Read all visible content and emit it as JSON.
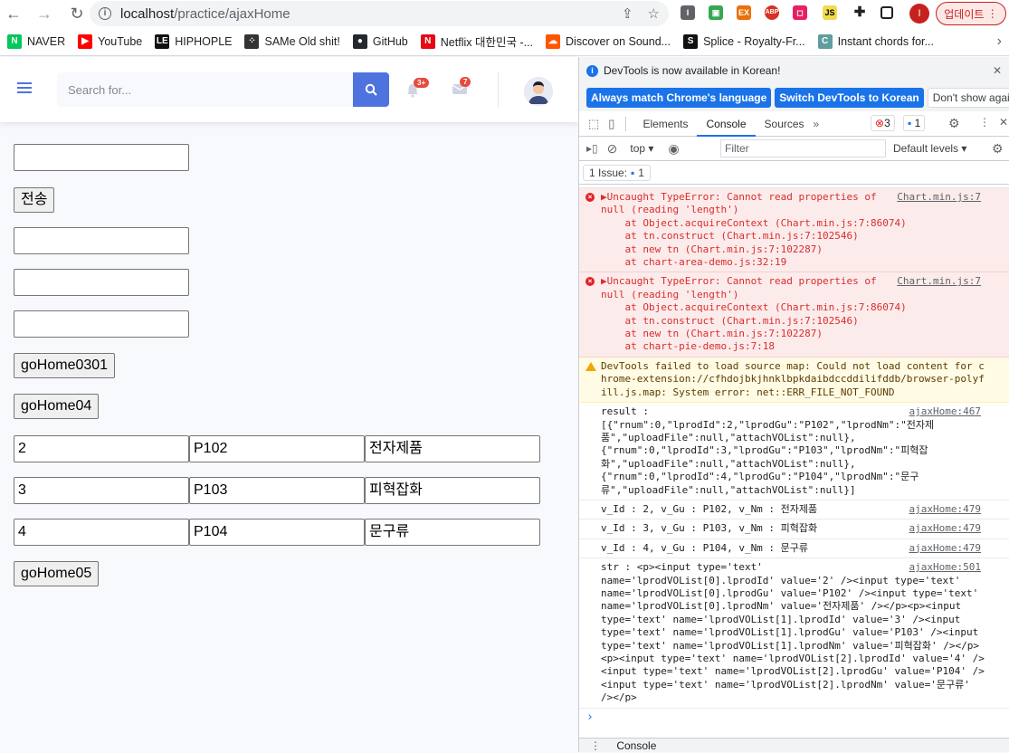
{
  "browser": {
    "url_host": "localhost",
    "url_path": "/practice/ajaxHome",
    "update_label": "업데이트",
    "profile_initial": "I"
  },
  "bookmarks": [
    {
      "label": "NAVER",
      "icon": "naver-icon",
      "color": "#03c75a",
      "glyph": "N"
    },
    {
      "label": "YouTube",
      "icon": "youtube-icon",
      "color": "#ff0000",
      "glyph": "▶"
    },
    {
      "label": "HIPHOPLE",
      "icon": "hiphople-icon",
      "color": "#111111",
      "glyph": "LE"
    },
    {
      "label": "SAMe Old shit!",
      "icon": "same-icon",
      "color": "#333333",
      "glyph": "⁘"
    },
    {
      "label": "GitHub",
      "icon": "github-icon",
      "color": "#24292e",
      "glyph": "●"
    },
    {
      "label": "Netflix 대한민국 -...",
      "icon": "netflix-icon",
      "color": "#e50914",
      "glyph": "N"
    },
    {
      "label": "Discover on Sound...",
      "icon": "soundcloud-icon",
      "color": "#ff5500",
      "glyph": "☁"
    },
    {
      "label": "Splice - Royalty-Fr...",
      "icon": "splice-icon",
      "color": "#111111",
      "glyph": "S"
    },
    {
      "label": "Instant chords for...",
      "icon": "chords-icon",
      "color": "#5f9ea0",
      "glyph": "C"
    }
  ],
  "header": {
    "search_placeholder": "Search for...",
    "alerts_badge": "3+",
    "messages_badge": "7"
  },
  "form": {
    "inputs_top": [
      "",
      "",
      "",
      ""
    ],
    "send_label": "전송",
    "go0301_label": "goHome0301",
    "go04_label": "goHome04",
    "rows": [
      {
        "id": "2",
        "gu": "P102",
        "nm": "전자제품"
      },
      {
        "id": "3",
        "gu": "P103",
        "nm": "피혁잡화"
      },
      {
        "id": "4",
        "gu": "P104",
        "nm": "문구류"
      }
    ],
    "go05_label": "goHome05"
  },
  "devtools": {
    "notice": "DevTools is now available in Korean!",
    "btn_match": "Always match Chrome's language",
    "btn_switch": "Switch DevTools to Korean",
    "btn_dismiss": "Don't show again",
    "tabs": [
      "Elements",
      "Console",
      "Sources"
    ],
    "active_tab": "Console",
    "error_count": "3",
    "info_count": "1",
    "context": "top",
    "filter_placeholder": "Filter",
    "levels": "Default levels",
    "issues": "1 Issue:",
    "issues_count": "1",
    "drawer_label": "Console"
  },
  "console": {
    "err1": {
      "text": "▶Uncaught TypeError: Cannot read properties of\nnull (reading 'length')",
      "src": "Chart.min.js:7",
      "stack": [
        "    at Object.acquireContext (Chart.min.js:7:86074)",
        "    at tn.construct (Chart.min.js:7:102546)",
        "    at new tn (Chart.min.js:7:102287)",
        "    at chart-area-demo.js:32:19"
      ]
    },
    "err2": {
      "text": "▶Uncaught TypeError: Cannot read properties of\nnull (reading 'length')",
      "src": "Chart.min.js:7",
      "stack": [
        "    at Object.acquireContext (Chart.min.js:7:86074)",
        "    at tn.construct (Chart.min.js:7:102546)",
        "    at new tn (Chart.min.js:7:102287)",
        "    at chart-pie-demo.js:7:18"
      ]
    },
    "warn": "DevTools failed to load source map: Could not load content for c\nhrome-extension://cfhdojbkjhnklbpkdaibdccddilifddb/browser-polyf\nill.js.map: System error: net::ERR_FILE_NOT_FOUND",
    "result": {
      "text": "result :\n[{\"rnum\":0,\"lprodId\":2,\"lprodGu\":\"P102\",\"lprodNm\":\"전자제\n품\",\"uploadFile\":null,\"attachVOList\":null},\n{\"rnum\":0,\"lprodId\":3,\"lprodGu\":\"P103\",\"lprodNm\":\"피혁잡\n화\",\"uploadFile\":null,\"attachVOList\":null},\n{\"rnum\":0,\"lprodId\":4,\"lprodGu\":\"P104\",\"lprodNm\":\"문구\n류\",\"uploadFile\":null,\"attachVOList\":null}]",
      "src": "ajaxHome:467"
    },
    "log1": {
      "text": "v_Id : 2, v_Gu : P102, v_Nm : 전자제품",
      "src": "ajaxHome:479"
    },
    "log2": {
      "text": "v_Id : 3, v_Gu : P103, v_Nm : 피혁잡화",
      "src": "ajaxHome:479"
    },
    "log3": {
      "text": "v_Id : 4, v_Gu : P104, v_Nm : 문구류",
      "src": "ajaxHome:479"
    },
    "str": {
      "text": "str : <p><input type='text'\nname='lprodVOList[0].lprodId' value='2' /><input type='text'\nname='lprodVOList[0].lprodGu' value='P102' /><input type='text'\nname='lprodVOList[0].lprodNm' value='전자제품' /></p><p><input\ntype='text' name='lprodVOList[1].lprodId' value='3' /><input\ntype='text' name='lprodVOList[1].lprodGu' value='P103' /><input\ntype='text' name='lprodVOList[1].lprodNm' value='피혁잡화' /></p>\n<p><input type='text' name='lprodVOList[2].lprodId' value='4' />\n<input type='text' name='lprodVOList[2].lprodGu' value='P104' />\n<input type='text' name='lprodVOList[2].lprodNm' value='문구류'\n/></p>",
      "src": "ajaxHome:501"
    }
  }
}
